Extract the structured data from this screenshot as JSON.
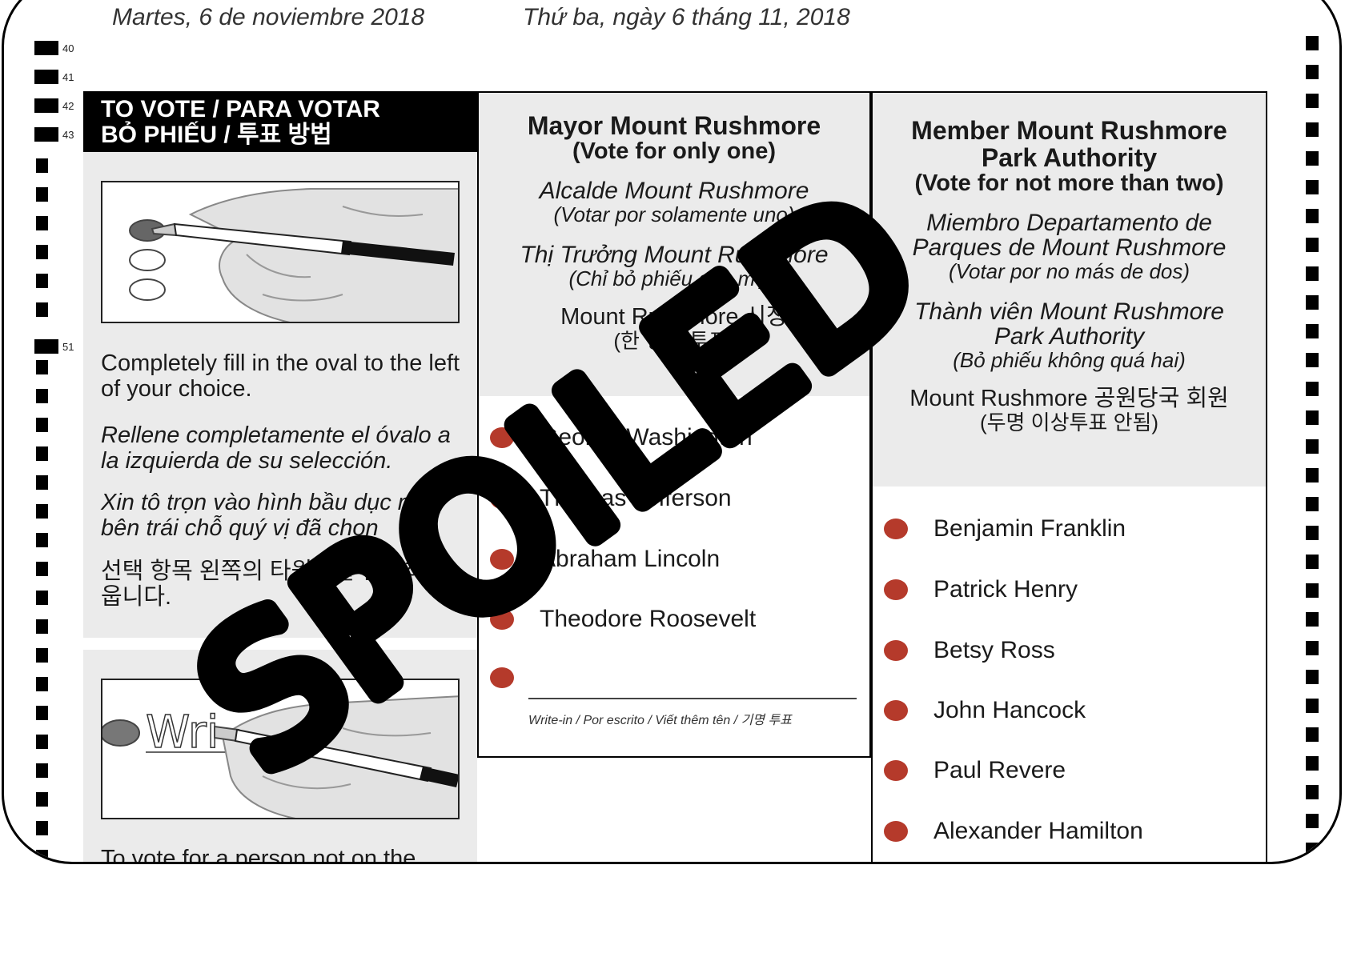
{
  "header": {
    "date_es": "Martes, 6 de noviembre 2018",
    "date_vi": "Thứ ba, ngày 6 tháng 11, 2018"
  },
  "row_numbers": [
    "40",
    "41",
    "42",
    "43",
    "51"
  ],
  "instructions": {
    "heading_line1": "TO VOTE / PARA VOTAR",
    "heading_line2": "BỎ PHIẾU / 투표 방법",
    "english": "Completely fill in the oval to the left of your choice.",
    "spanish": "Rellene completamente el óvalo a la izquierda de su selección.",
    "vietnamese": "Xin tô trọn vào hình bầu dục nằm bên trái chỗ quý vị đã chọn",
    "korean": "선택 항목 왼쪽의 타원형을 완전히 채웁니다.",
    "writein_example_text": "Wri",
    "writein_instruction": "To vote for a person not on the"
  },
  "mayor": {
    "title": "Mayor Mount Rushmore",
    "rule": "(Vote for only one)",
    "title_es": "Alcalde Mount Rushmore",
    "rule_es": "(Votar por solamente uno)",
    "title_vi": "Thị Trưởng Mount Rushmore",
    "rule_vi": "(Chỉ bỏ phiếu cho một)",
    "title_ko": "Mount Rushmore 시장",
    "rule_ko": "(한 명만 투표)",
    "candidates": [
      "George Washington",
      "Thomas Jefferson",
      "Abraham Lincoln",
      "Theodore Roosevelt"
    ],
    "writein_label": "Write-in  /  Por escrito  /  Viết thêm tên  /  기명 투표"
  },
  "park": {
    "title_line1": "Member Mount Rushmore",
    "title_line2": "Park Authority",
    "rule": "(Vote for not more than two)",
    "title_es_line1": "Miembro Departamento de",
    "title_es_line2": "Parques de Mount Rushmore",
    "rule_es": "(Votar por no más de dos)",
    "title_vi_line1": "Thành viên Mount Rushmore",
    "title_vi_line2": "Park Authority",
    "rule_vi": "(Bỏ phiếu không quá hai)",
    "title_ko": "Mount Rushmore 공원당국 회원",
    "rule_ko": "(두명 이상투표 안됨)",
    "candidates": [
      "Benjamin Franklin",
      "Patrick Henry",
      "Betsy Ross",
      "John Hancock",
      "Paul Revere",
      "Alexander Hamilton"
    ]
  },
  "stamp": {
    "text": "SPOILED",
    "color": "#000000"
  },
  "colors": {
    "mark_oval": "#b53a2b",
    "panel_gray": "#ebebeb"
  }
}
